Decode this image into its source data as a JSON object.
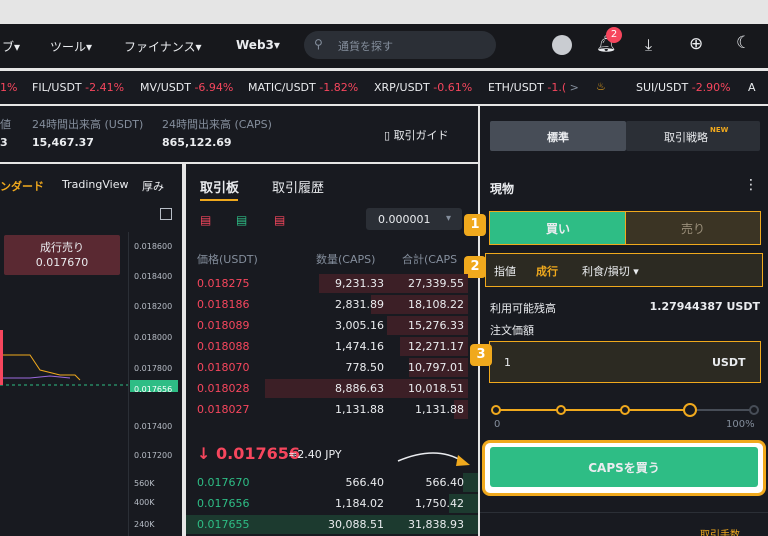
{
  "nav": {
    "items": [
      "ブ▾",
      "ツール▾",
      "ファイナンス▾",
      "Web3▾"
    ],
    "search_placeholder": "通貨を探す",
    "notif_count": "2"
  },
  "ticker": [
    {
      "pair": "",
      "change": "1%",
      "dir": "down"
    },
    {
      "pair": "FIL/USDT",
      "change": "-2.41%",
      "dir": "down"
    },
    {
      "pair": "MV/USDT",
      "change": "-6.94%",
      "dir": "down"
    },
    {
      "pair": "MATIC/USDT",
      "change": "-1.82%",
      "dir": "down"
    },
    {
      "pair": "XRP/USDT",
      "change": "-0.61%",
      "dir": "down"
    },
    {
      "pair": "ETH/USDT",
      "change": "-1.(",
      "dir": "down"
    },
    {
      "pair": "SUI/USDT",
      "change": "-2.90%",
      "dir": "down"
    },
    {
      "pair": "A",
      "change": "",
      "dir": "down"
    }
  ],
  "stats": {
    "label_left": "値",
    "value_left": "3",
    "high_usdt_label": "24時間出来高 (USDT)",
    "high_usdt_value": "15,467.37",
    "high_caps_label": "24時間出来高 (CAPS)",
    "high_caps_value": "865,122.69",
    "guide": "取引ガイド"
  },
  "chart": {
    "tabs": [
      "ンダード",
      "TradingView",
      "厚み"
    ],
    "sell_label": "成行売り",
    "sell_price": "0.017670",
    "price_ticks": [
      "0.018600",
      "0.018400",
      "0.018200",
      "0.018000",
      "0.017800",
      "0.017656",
      "0.017400",
      "0.017200"
    ],
    "vol_ticks": [
      "560K",
      "400K",
      "240K"
    ]
  },
  "orderbook": {
    "tab_active": "取引板",
    "tab_other": "取引履歴",
    "precision": "0.000001",
    "headers": [
      "価格(USDT)",
      "数量(CAPS)",
      "合計(CAPS"
    ],
    "asks": [
      {
        "price": "0.018275",
        "qty": "9,231.33",
        "total": "27,339.55",
        "depth": 0.55
      },
      {
        "price": "0.018186",
        "qty": "2,831.89",
        "total": "18,108.22",
        "depth": 0.36
      },
      {
        "price": "0.018089",
        "qty": "3,005.16",
        "total": "15,276.33",
        "depth": 0.3
      },
      {
        "price": "0.018088",
        "qty": "1,474.16",
        "total": "12,271.17",
        "depth": 0.25
      },
      {
        "price": "0.018070",
        "qty": "778.50",
        "total": "10,797.01",
        "depth": 0.22
      },
      {
        "price": "0.018028",
        "qty": "8,886.63",
        "total": "10,018.51",
        "depth": 0.75
      },
      {
        "price": "0.018027",
        "qty": "1,131.88",
        "total": "1,131.88",
        "depth": 0.05
      }
    ],
    "last_price": "↓ 0.017656",
    "last_jpy": "≈2.40 JPY",
    "bids": [
      {
        "price": "0.017670",
        "qty": "566.40",
        "total": "566.40",
        "depth": 0.05
      },
      {
        "price": "0.017656",
        "qty": "1,184.02",
        "total": "1,750.42",
        "depth": 0.1
      },
      {
        "price": "0.017655",
        "qty": "30,088.51",
        "total": "31,838.93",
        "depth": 1.0
      }
    ]
  },
  "trade": {
    "mode_standard": "標準",
    "mode_strategy": "取引戦略",
    "mode_strategy_badge": "NEW",
    "section_title": "現物",
    "buy": "買い",
    "sell": "売り",
    "order_types": [
      "指値",
      "成行",
      "利食/損切 ▾"
    ],
    "available_label": "利用可能残高",
    "available_value": "1.27944387 USDT",
    "price_label": "注文価額",
    "amount_value": "1",
    "amount_unit": "USDT",
    "slider_min": "0",
    "slider_max": "100%",
    "slider_value": 0.75,
    "buy_button": "CAPSを買う",
    "footer_link": "取引手数"
  },
  "callouts": [
    "1",
    "2",
    "3"
  ]
}
